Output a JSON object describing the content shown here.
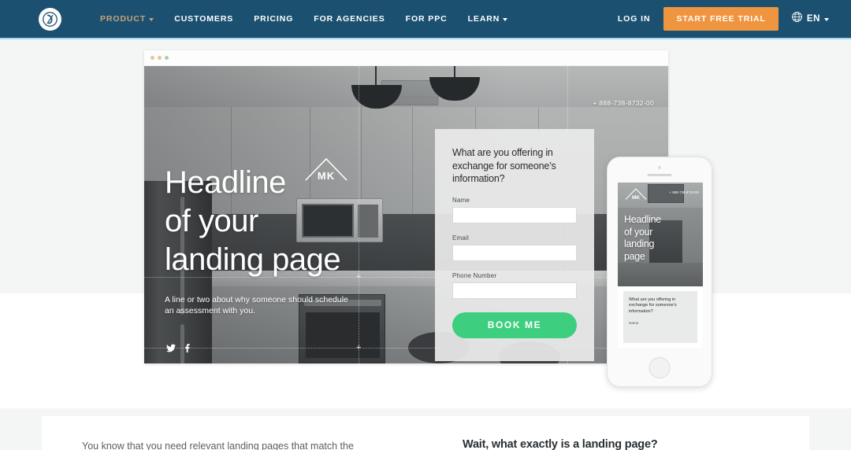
{
  "nav": {
    "logo_icon": "unbounce-logo-icon",
    "links": [
      {
        "label": "PRODUCT",
        "active": true,
        "caret": true
      },
      {
        "label": "CUSTOMERS",
        "active": false,
        "caret": false
      },
      {
        "label": "PRICING",
        "active": false,
        "caret": false
      },
      {
        "label": "FOR AGENCIES",
        "active": false,
        "caret": false
      },
      {
        "label": "FOR PPC",
        "active": false,
        "caret": false
      },
      {
        "label": "LEARN",
        "active": false,
        "caret": true
      }
    ],
    "login_label": "LOG IN",
    "trial_label": "START FREE TRIAL",
    "lang_label": "EN",
    "globe_icon": "globe-icon",
    "colors": {
      "bar": "#1c5070",
      "accent_underline": "#9fd8e8",
      "active_link": "#c6a377",
      "cta": "#ef9540"
    }
  },
  "browser": {
    "dots": [
      "red-dot",
      "yellow-dot",
      "green-dot"
    ]
  },
  "landing_preview": {
    "brand_mark": "MK",
    "brand_icon": "house-roof-icon",
    "phone_number": "+ 888-738-8732-00",
    "headline": "Headline\nof your\nlanding page",
    "subline": "A line or two about why someone should schedule an assessment with you.",
    "social": [
      "twitter-icon",
      "facebook-icon"
    ],
    "form": {
      "title": "What are you offering in exchange for someone’s information?",
      "fields": [
        {
          "label": "Name",
          "value": ""
        },
        {
          "label": "Email",
          "value": ""
        },
        {
          "label": "Phone Number",
          "value": ""
        }
      ],
      "submit_label": "BOOK ME",
      "submit_color": "#3ece7f"
    }
  },
  "mobile_preview": {
    "brand_mark": "MK",
    "phone_number": "+ 888-738-8732-00",
    "headline": "Headline\nof your\nlanding\npage",
    "form_title": "What are you offering in exchange for someone’s information?",
    "first_field_label": "Name"
  },
  "content": {
    "left_paragraph": "You know that you need relevant landing pages that match the",
    "right_heading": "Wait, what exactly is a landing page?"
  }
}
